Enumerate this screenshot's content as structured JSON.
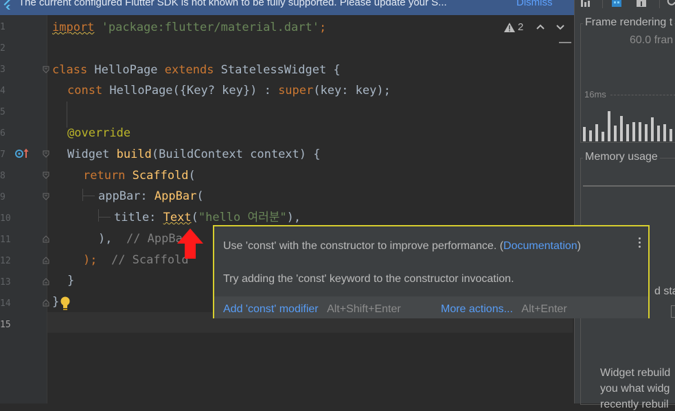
{
  "banner": {
    "message": "The current configured Flutter SDK is not known to be fully supported. Please update your S...",
    "dismiss": "Dismiss"
  },
  "editor": {
    "line_numbers": [
      "1",
      "2",
      "3",
      "4",
      "5",
      "6",
      "7",
      "8",
      "9",
      "10",
      "11",
      "12",
      "13",
      "14",
      "15"
    ],
    "warnings_count": "2",
    "lines": {
      "l1_kw": "import",
      "l1_str": "'package:flutter/material.dart'",
      "l1_end": ";",
      "l3_kw1": "class",
      "l3_name": " HelloPage ",
      "l3_kw2": "extends",
      "l3_rest": " StatelessWidget {",
      "l4_kw": "const",
      "l4_rest": " HelloPage({Key? key}) : ",
      "l4_super": "super",
      "l4_end": "(key: key);",
      "l6_ann": "@override",
      "l7_type": "Widget ",
      "l7_fn": "build",
      "l7_rest": "(BuildContext context) {",
      "l8_kw": "return",
      "l8_fn": " Scaffold",
      "l8_end": "(",
      "l9_prop": "appBar: ",
      "l9_fn": "AppBar",
      "l9_end": "(",
      "l10_prop": "title: ",
      "l10_fn": "Text",
      "l10_paren": "(",
      "l10_str": "\"hello 여러분\"",
      "l10_end": "),",
      "l11_a": "),",
      "l11_cmt": "// AppBar",
      "l12_a": ");",
      "l12_cmt": "// Scaffold",
      "l13_a": "}",
      "l14_a": "}"
    }
  },
  "popup": {
    "message_prefix": "Use 'const' with the constructor to improve performance. (",
    "doc_link": "Documentation",
    "message_suffix": ")",
    "hint": "Try adding the 'const' keyword to the constructor invocation.",
    "action1": "Add 'const' modifier",
    "action1_shortcut": "Alt+Shift+Enter",
    "action2": "More actions...",
    "action2_shortcut": "Alt+Enter"
  },
  "right_panel": {
    "frame_title": "Frame rendering t",
    "fps": "60.0 fran",
    "ms_label": "16ms",
    "frame_bar_levels": [
      0.45,
      0.35,
      0.55,
      0.3,
      0.95,
      0.5,
      0.8,
      0.55,
      0.6,
      0.6,
      0.55,
      0.75,
      0.5,
      0.55,
      0.4
    ],
    "memory_title": "Memory usage",
    "partial_label": "d sta",
    "widget_text1": "Widget rebuild",
    "widget_text2": "you what widg",
    "widget_text3": "recently rebuil"
  },
  "colors": {
    "accent_link": "#589df6",
    "popup_border": "#d8cf2e",
    "banner_bg": "#3c5a8a"
  }
}
